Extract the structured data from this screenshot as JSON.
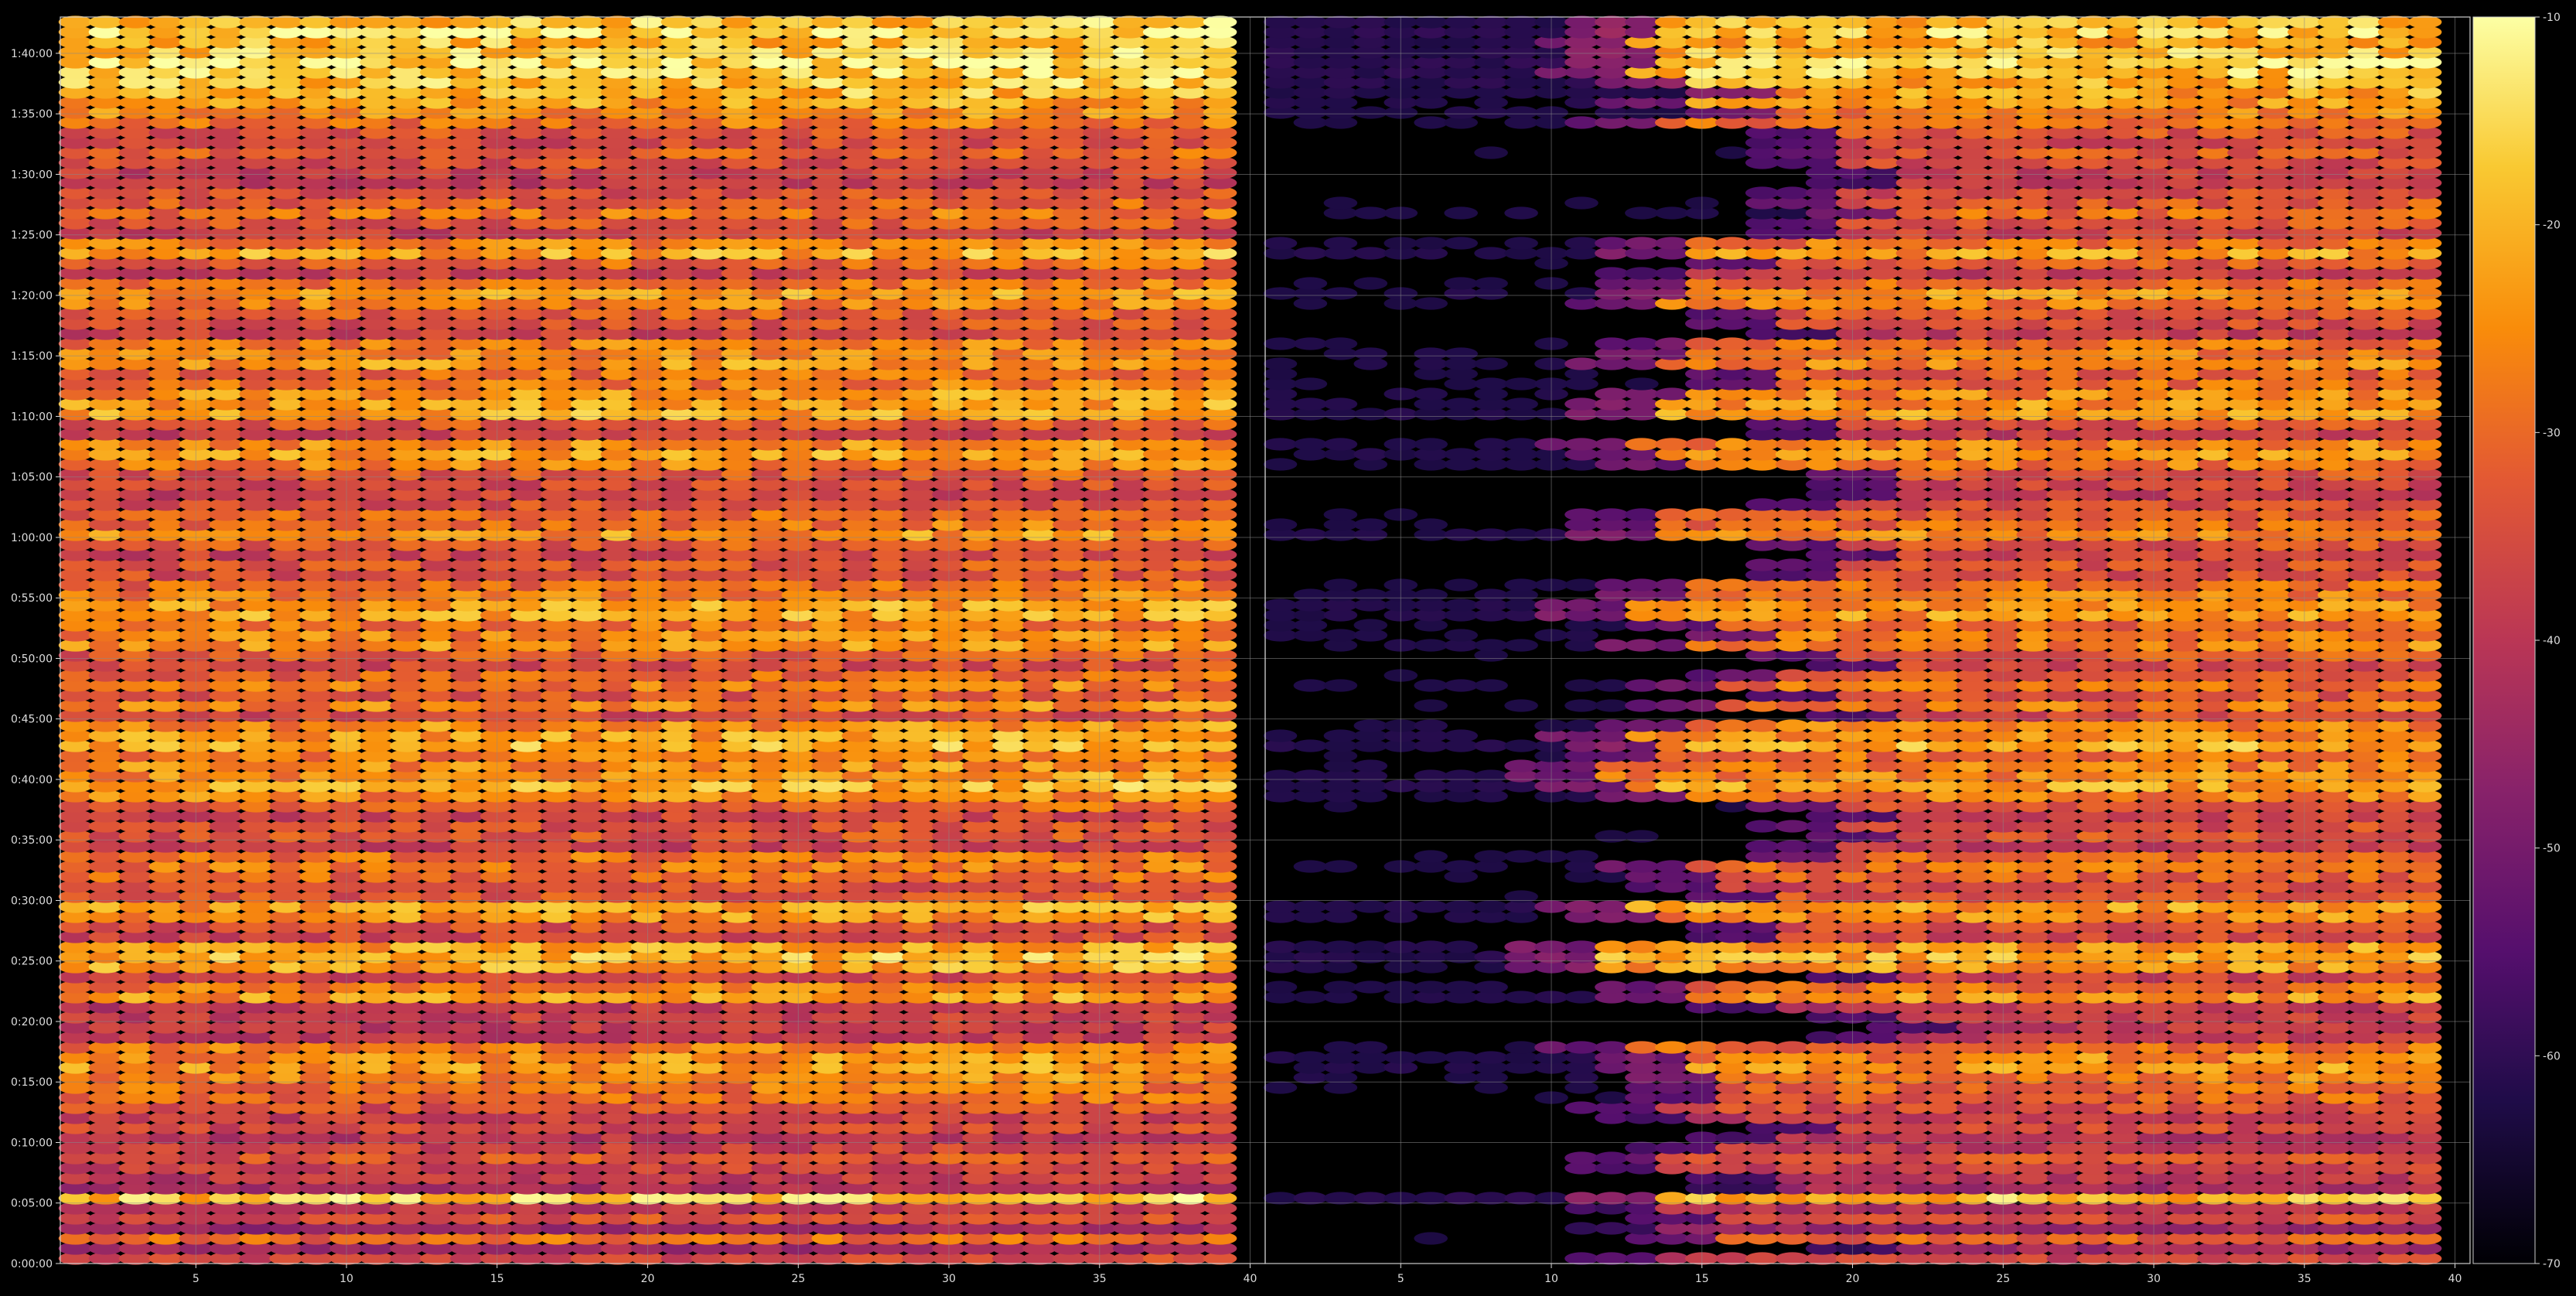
{
  "chart_data": {
    "type": "heatmap",
    "title": "",
    "colormap": "inferno",
    "background": "#000000",
    "grid": true,
    "panels": [
      {
        "id": "left",
        "xlim": [
          1,
          40
        ],
        "xticks": [
          5,
          10,
          15,
          20,
          25,
          30,
          35,
          40
        ],
        "row_strength": [
          0.88,
          0.95,
          0.86,
          0.9,
          0.96,
          0.92,
          0.88,
          0.85,
          0.8,
          0.76,
          0.7,
          0.62,
          0.58,
          0.66,
          0.6,
          0.55,
          0.52,
          0.6,
          0.65,
          0.7,
          0.62,
          0.55,
          0.74,
          0.82,
          0.66,
          0.55,
          0.7,
          0.8,
          0.73,
          0.64,
          0.6,
          0.55,
          0.72,
          0.74,
          0.78,
          0.68,
          0.7,
          0.78,
          0.8,
          0.82,
          0.62,
          0.55,
          0.76,
          0.8,
          0.73,
          0.63,
          0.58,
          0.55,
          0.6,
          0.66,
          0.7,
          0.78,
          0.63,
          0.56,
          0.62,
          0.6,
          0.68,
          0.72,
          0.8,
          0.82,
          0.7,
          0.74,
          0.76,
          0.64,
          0.58,
          0.66,
          0.72,
          0.62,
          0.74,
          0.58,
          0.76,
          0.8,
          0.86,
          0.72,
          0.76,
          0.78,
          0.84,
          0.75,
          0.66,
          0.56,
          0.6,
          0.62,
          0.54,
          0.7,
          0.72,
          0.68,
          0.6,
          0.62,
          0.82,
          0.78,
          0.6,
          0.58,
          0.82,
          0.86,
          0.82,
          0.56,
          0.72,
          0.8,
          0.52,
          0.54,
          0.52,
          0.52,
          0.72,
          0.78,
          0.8,
          0.76,
          0.7,
          0.68,
          0.6,
          0.54,
          0.58,
          0.5,
          0.55,
          0.62,
          0.56,
          0.52,
          0.46,
          0.9,
          0.5,
          0.6,
          0.42,
          0.68,
          0.44,
          0.56
        ],
        "onset": []
      },
      {
        "id": "right",
        "xlim": [
          1,
          40
        ],
        "xticks": [
          5,
          10,
          15,
          20,
          25,
          30,
          35,
          40
        ],
        "row_strength": [
          0.84,
          0.9,
          0.82,
          0.86,
          0.9,
          0.88,
          0.84,
          0.8,
          0.76,
          0.72,
          0.68,
          0.6,
          0.56,
          0.62,
          0.58,
          0.52,
          0.5,
          0.58,
          0.62,
          0.68,
          0.6,
          0.54,
          0.7,
          0.78,
          0.62,
          0.52,
          0.66,
          0.76,
          0.7,
          0.62,
          0.58,
          0.52,
          0.68,
          0.7,
          0.74,
          0.64,
          0.66,
          0.74,
          0.76,
          0.78,
          0.6,
          0.52,
          0.72,
          0.76,
          0.7,
          0.6,
          0.56,
          0.52,
          0.58,
          0.62,
          0.66,
          0.74,
          0.6,
          0.54,
          0.6,
          0.58,
          0.66,
          0.7,
          0.76,
          0.78,
          0.66,
          0.7,
          0.72,
          0.62,
          0.56,
          0.62,
          0.68,
          0.6,
          0.7,
          0.56,
          0.72,
          0.76,
          0.82,
          0.68,
          0.72,
          0.74,
          0.8,
          0.72,
          0.62,
          0.54,
          0.58,
          0.6,
          0.52,
          0.66,
          0.68,
          0.64,
          0.58,
          0.6,
          0.78,
          0.74,
          0.58,
          0.56,
          0.78,
          0.82,
          0.78,
          0.54,
          0.68,
          0.76,
          0.5,
          0.52,
          0.5,
          0.5,
          0.68,
          0.74,
          0.76,
          0.72,
          0.66,
          0.64,
          0.58,
          0.52,
          0.56,
          0.48,
          0.52,
          0.6,
          0.54,
          0.5,
          0.44,
          0.86,
          0.48,
          0.58,
          0.4,
          0.64,
          0.42,
          0.54
        ],
        "onset": [
          14,
          14,
          13,
          14,
          14,
          13,
          15,
          18,
          15,
          18,
          14,
          20,
          20,
          20,
          20,
          22,
          22,
          20,
          20,
          22,
          20,
          20,
          15,
          15,
          18,
          15,
          15,
          15,
          14,
          18,
          18,
          20,
          15,
          15,
          14,
          18,
          18,
          15,
          14,
          14,
          20,
          20,
          13,
          14,
          15,
          22,
          22,
          22,
          20,
          14,
          14,
          14,
          20,
          22,
          20,
          20,
          15,
          15,
          13,
          13,
          16,
          18,
          15,
          20,
          22,
          18,
          16,
          20,
          16,
          22,
          15,
          13,
          14,
          14,
          12,
          12,
          13,
          15,
          20,
          22,
          20,
          22,
          20,
          20,
          15,
          16,
          16,
          18,
          13,
          14,
          18,
          18,
          12,
          12,
          12,
          22,
          15,
          15,
          18,
          22,
          24,
          22,
          13,
          15,
          15,
          16,
          16,
          16,
          14,
          15,
          20,
          18,
          16,
          14,
          14,
          18,
          18,
          14,
          14,
          16,
          14,
          16,
          22,
          14
        ]
      }
    ],
    "rows": 124,
    "cols_per_panel": 39,
    "yticks": [
      "0:00:00",
      "0:05:00",
      "0:10:00",
      "0:15:00",
      "0:20:00",
      "0:25:00",
      "0:30:00",
      "0:35:00",
      "0:40:00",
      "0:45:00",
      "0:50:00",
      "0:55:00",
      "1:00:00",
      "1:05:00",
      "1:10:00",
      "1:15:00",
      "1:20:00",
      "1:25:00",
      "1:30:00",
      "1:35:00",
      "1:40:00"
    ],
    "y_range_seconds": [
      0,
      6180
    ],
    "colorbar": {
      "vmin": -70,
      "vmax": -10,
      "ticks": [
        -70,
        -60,
        -50,
        -40,
        -30,
        -20,
        -10
      ]
    }
  }
}
